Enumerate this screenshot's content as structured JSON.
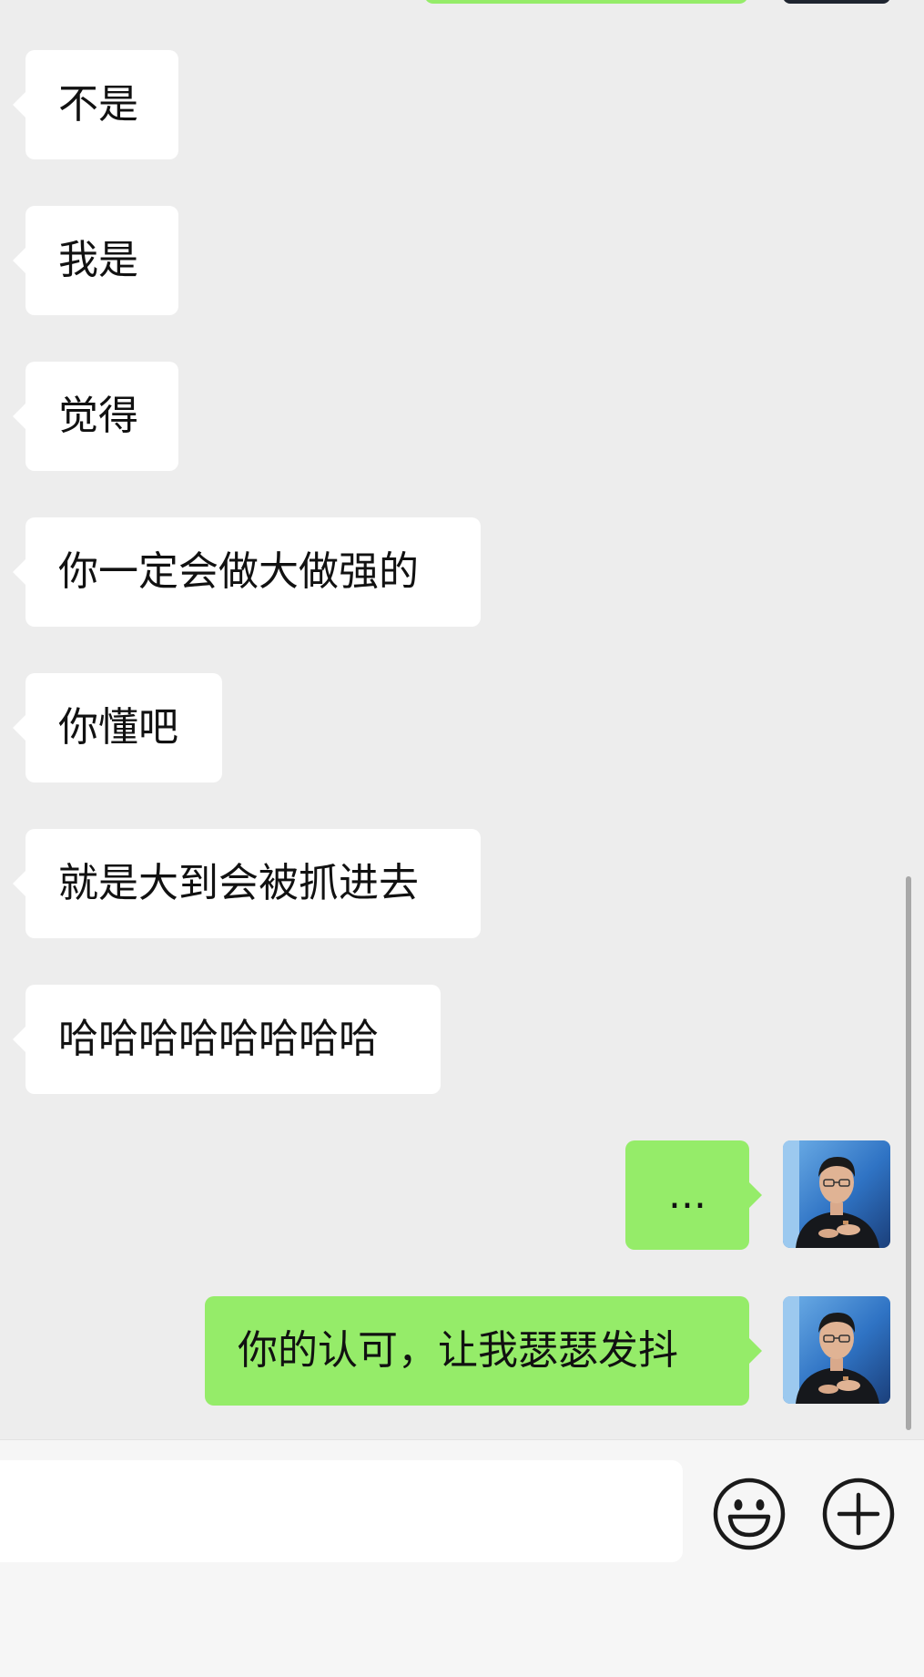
{
  "messages": [
    {
      "direction": "in",
      "text": "不是"
    },
    {
      "direction": "in",
      "text": "我是"
    },
    {
      "direction": "in",
      "text": "觉得"
    },
    {
      "direction": "in",
      "text": "你一定会做大做强的"
    },
    {
      "direction": "in",
      "text": "你懂吧"
    },
    {
      "direction": "in",
      "text": "就是大到会被抓进去"
    },
    {
      "direction": "in",
      "text": "哈哈哈哈哈哈哈哈"
    },
    {
      "direction": "out",
      "text": "..."
    },
    {
      "direction": "out",
      "text": "你的认可，让我瑟瑟发抖"
    }
  ],
  "input": {
    "value": "",
    "placeholder": ""
  },
  "icons": {
    "emoji": "smiley-face-icon",
    "more": "plus-circle-icon"
  },
  "colors": {
    "background": "#ededed",
    "incoming_bubble": "#ffffff",
    "outgoing_bubble": "#95ec69",
    "input_bar": "#f6f6f6"
  }
}
